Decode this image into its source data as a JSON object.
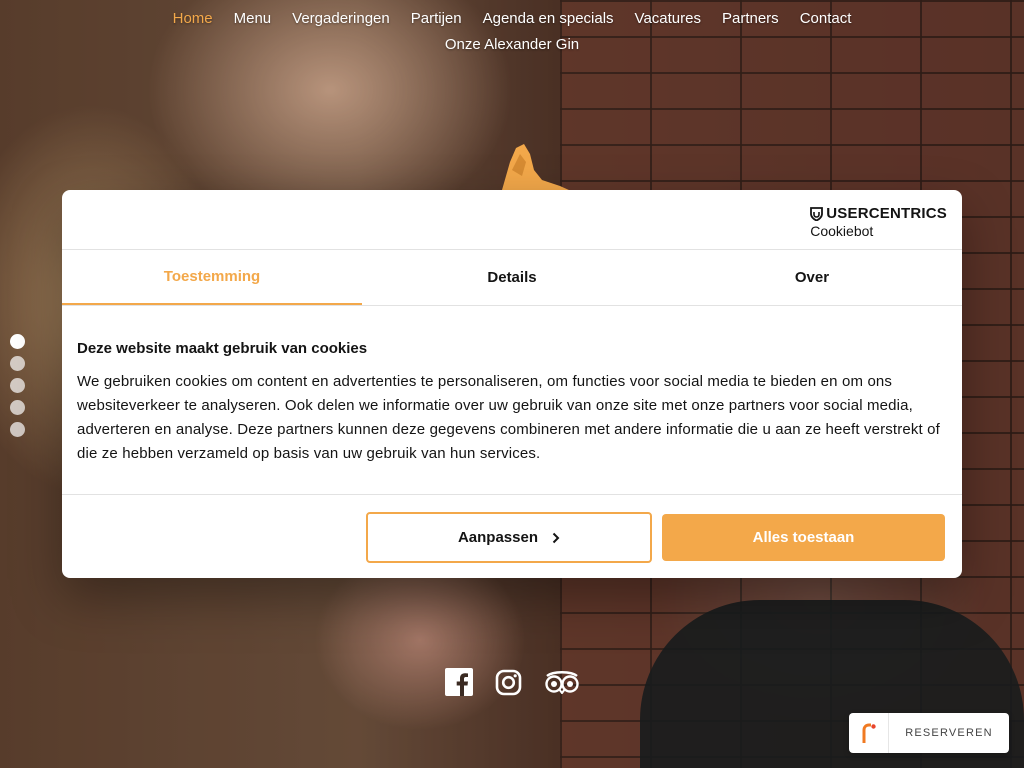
{
  "nav": {
    "items": [
      "Home",
      "Menu",
      "Vergaderingen",
      "Partijen",
      "Agenda en specials",
      "Vacatures",
      "Partners",
      "Contact"
    ],
    "second_row": "Onze Alexander Gin",
    "active": "Home"
  },
  "slider": {
    "dot_count": 5,
    "active_index": 0
  },
  "cookie_dialog": {
    "brand_name": "USERCENTRICS",
    "brand_sub": "Cookiebot",
    "tabs": [
      "Toestemming",
      "Details",
      "Over"
    ],
    "active_tab": "Toestemming",
    "title": "Deze website maakt gebruik van cookies",
    "text": "We gebruiken cookies om content en advertenties te personaliseren, om functies voor social media te bieden en om ons websiteverkeer te analyseren. Ook delen we informatie over uw gebruik van onze site met onze partners voor social media, adverteren en analyse. Deze partners kunnen deze gegevens combineren met andere informatie die u aan ze heeft verstrekt of die ze hebben verzameld op basis van uw gebruik van hun services.",
    "customize_label": "Aanpassen",
    "allow_all_label": "Alles toestaan"
  },
  "social": [
    "facebook-icon",
    "instagram-icon",
    "tripadvisor-icon"
  ],
  "reserve_widget": {
    "label": "RESERVEREN"
  },
  "colors": {
    "accent": "#f3a84a",
    "text": "#141414",
    "divider": "#e2e2e2"
  }
}
